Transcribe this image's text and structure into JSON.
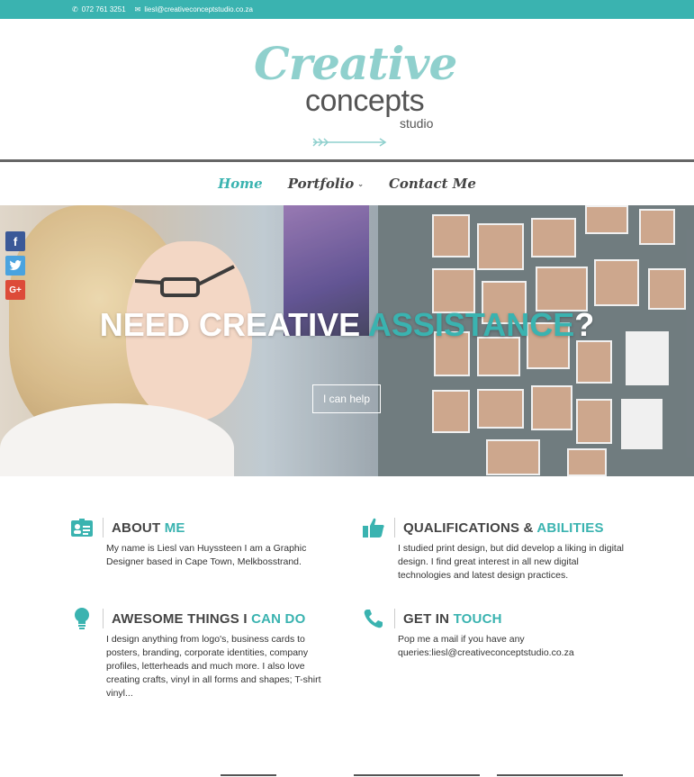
{
  "topbar": {
    "phone": "072 761 3251",
    "email": "liesl@creativeconceptstudio.co.za"
  },
  "logo": {
    "line1": "Creative",
    "line2": "concepts",
    "line3": "studio"
  },
  "nav": {
    "home": "Home",
    "portfolio": "Portfolio",
    "contact": "Contact Me"
  },
  "hero": {
    "title_part1": "NEED CREATIVE ",
    "title_accent": "ASSISTANCE",
    "title_end": "?",
    "button": "I can help"
  },
  "social": {
    "facebook": "f",
    "twitter": "t",
    "googleplus": "G+"
  },
  "blocks": [
    {
      "title": "ABOUT ",
      "accent": "ME",
      "text": "My name is Liesl van Huyssteen I am a Graphic Designer based in Cape Town, Melkbosstrand.",
      "icon": "id-card-icon"
    },
    {
      "title": "QUALIFICATIONS & ",
      "accent": "ABILITIES",
      "text": "I studied print design, but did develop a liking in digital design. I find great interest in all new digital technologies and latest design practices.",
      "icon": "thumbs-up-icon"
    },
    {
      "title": "AWESOME THINGS I ",
      "accent": "CAN DO",
      "text": "I design anything from logo's, business cards to posters, branding, corporate identities, company profiles, letterheads and much more. I also love creating crafts, vinyl in all forms and shapes; T-shirt vinyl...",
      "icon": "lightbulb-icon"
    },
    {
      "title": "GET IN ",
      "accent": "TOUCH",
      "text": "Pop me a mail if you have any queries:liesl@creativeconceptstudio.co.za",
      "icon": "phone-icon"
    }
  ],
  "colors": {
    "accent": "#3ab3b0",
    "text": "#444444"
  }
}
